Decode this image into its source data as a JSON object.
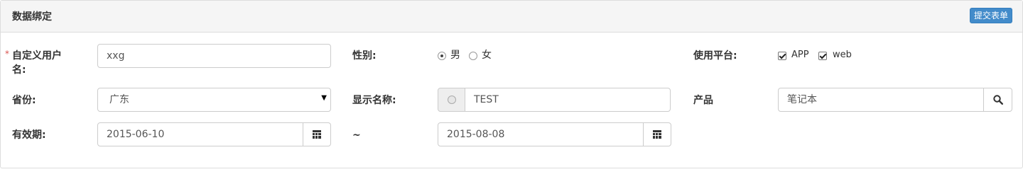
{
  "panel": {
    "title": "数据绑定",
    "submit_label": "提交表单"
  },
  "form": {
    "required_mark": "*",
    "username": {
      "label_line1": "自定义用户",
      "label_line2": "名:",
      "value": "xxg"
    },
    "gender": {
      "label": "性别:",
      "options": [
        "男",
        "女"
      ],
      "selected": "男"
    },
    "platform": {
      "label": "使用平台:",
      "options": [
        "APP",
        "web"
      ],
      "checked": [
        "APP",
        "web"
      ]
    },
    "province": {
      "label": "省份:",
      "value": "广东"
    },
    "display_name": {
      "label": "显示名称:",
      "value": "TEST"
    },
    "product": {
      "label": "产品",
      "value": "笔记本"
    },
    "validity": {
      "label": "有效期:",
      "start": "2015-06-10",
      "separator": "~",
      "end": "2015-08-08"
    }
  },
  "icons": {
    "search": "search-icon",
    "calendar": "calendar-icon",
    "select_caret": "caret-down-icon"
  },
  "colors": {
    "primary_button": "#428bca",
    "required": "#d9534f",
    "heading_bg": "#f5f5f5"
  }
}
